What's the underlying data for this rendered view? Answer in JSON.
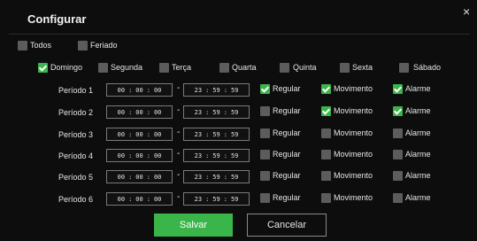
{
  "dialog": {
    "title": "Configurar",
    "close_symbol": "×"
  },
  "top_options": [
    {
      "label": "Todos",
      "checked": false
    },
    {
      "label": "Feriado",
      "checked": false
    }
  ],
  "days": [
    {
      "label": "Domingo",
      "checked": true
    },
    {
      "label": "Segunda",
      "checked": false
    },
    {
      "label": "Terça",
      "checked": false
    },
    {
      "label": "Quarta",
      "checked": false
    },
    {
      "label": "Quinta",
      "checked": false
    },
    {
      "label": "Sexta",
      "checked": false
    },
    {
      "label": "Sábado",
      "checked": false
    }
  ],
  "time_separator": "-",
  "periods": [
    {
      "label": "Período 1",
      "start": [
        "00",
        "00",
        "00"
      ],
      "end": [
        "23",
        "59",
        "59"
      ],
      "regular": true,
      "motion": true,
      "alarm": true
    },
    {
      "label": "Período 2",
      "start": [
        "00",
        "00",
        "00"
      ],
      "end": [
        "23",
        "59",
        "59"
      ],
      "regular": false,
      "motion": true,
      "alarm": true
    },
    {
      "label": "Período 3",
      "start": [
        "00",
        "00",
        "00"
      ],
      "end": [
        "23",
        "59",
        "59"
      ],
      "regular": false,
      "motion": false,
      "alarm": false
    },
    {
      "label": "Período 4",
      "start": [
        "00",
        "00",
        "00"
      ],
      "end": [
        "23",
        "59",
        "59"
      ],
      "regular": false,
      "motion": false,
      "alarm": false
    },
    {
      "label": "Período 5",
      "start": [
        "00",
        "00",
        "00"
      ],
      "end": [
        "23",
        "59",
        "59"
      ],
      "regular": false,
      "motion": false,
      "alarm": false
    },
    {
      "label": "Período 6",
      "start": [
        "00",
        "00",
        "00"
      ],
      "end": [
        "23",
        "59",
        "59"
      ],
      "regular": false,
      "motion": false,
      "alarm": false
    }
  ],
  "record_types": {
    "regular": "Regular",
    "motion": "Movimento",
    "alarm": "Alarme"
  },
  "buttons": {
    "save": "Salvar",
    "cancel": "Cancelar"
  },
  "colors": {
    "accent": "#39b54a",
    "background": "#0d0d0d",
    "checkbox_off": "#5c5c5c"
  }
}
